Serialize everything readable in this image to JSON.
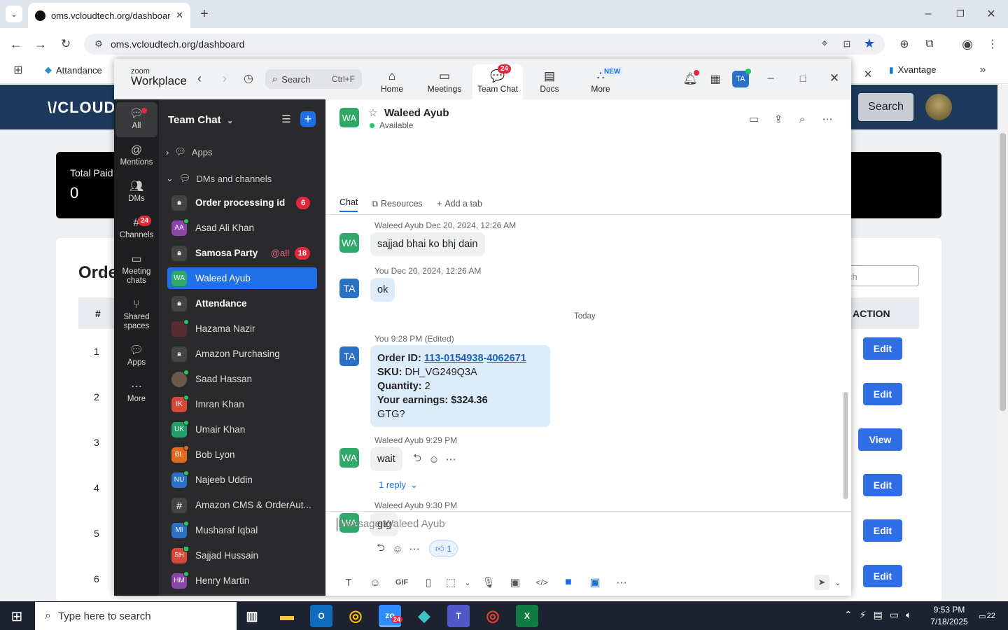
{
  "browser": {
    "tab_title": "oms.vcloudtech.org/dashboard",
    "url": "oms.vcloudtech.org/dashboard",
    "bookmarks": [
      "Attandance",
      "Xvantage"
    ]
  },
  "website": {
    "logo_text": "\\/CLOUDC",
    "search_button": "Search",
    "card_label": "Total Paid",
    "card_value": "0",
    "section_title": "Orde",
    "search_placeholder": "ch",
    "col_hash": "#",
    "col_action": "ACTION",
    "rows": [
      {
        "num": "1",
        "action": "Edit"
      },
      {
        "num": "2",
        "action": "Edit"
      },
      {
        "num": "3",
        "action": "View"
      },
      {
        "num": "4",
        "action": "Edit"
      },
      {
        "num": "5",
        "action": "Edit"
      },
      {
        "num": "6",
        "action": "Edit"
      }
    ]
  },
  "zoom": {
    "brand_small": "zoom",
    "brand": "Workplace",
    "search_label": "Search",
    "search_shortcut": "Ctrl+F",
    "nav": [
      {
        "label": "Home",
        "icon": "home-icon"
      },
      {
        "label": "Meetings",
        "icon": "video-icon"
      },
      {
        "label": "Team Chat",
        "icon": "chat-icon",
        "badge": "24"
      },
      {
        "label": "Docs",
        "icon": "doc-icon"
      },
      {
        "label": "More",
        "icon": "more-icon",
        "badge": "NEW"
      }
    ],
    "profile_initials": "TA",
    "rail": [
      {
        "label": "All"
      },
      {
        "label": "Mentions"
      },
      {
        "label": "DMs"
      },
      {
        "label": "Channels",
        "badge": "24"
      },
      {
        "label": "Meeting chats"
      },
      {
        "label": "Shared spaces"
      },
      {
        "label": "Apps"
      },
      {
        "label": "More"
      }
    ],
    "sidebar": {
      "title": "Team Chat",
      "apps_label": "Apps",
      "dms_label": "DMs and channels",
      "items": [
        {
          "name": "Order processing id",
          "badge": "6"
        },
        {
          "name": "Asad Ali Khan",
          "initials": "AA"
        },
        {
          "name": "Samosa Party",
          "mention": "@all",
          "badge": "18"
        },
        {
          "name": "Waleed Ayub",
          "initials": "WA"
        },
        {
          "name": "Attendance"
        },
        {
          "name": "Hazama Nazir"
        },
        {
          "name": "Amazon Purchasing"
        },
        {
          "name": "Saad Hassan"
        },
        {
          "name": "Imran Khan",
          "initials": "IK"
        },
        {
          "name": "Umair Khan",
          "initials": "UK"
        },
        {
          "name": "Bob Lyon",
          "initials": "BL"
        },
        {
          "name": "Najeeb Uddin",
          "initials": "NU"
        },
        {
          "name": "Amazon CMS & OrderAut...",
          "initials": "#"
        },
        {
          "name": "Musharaf Iqbal",
          "initials": "MI"
        },
        {
          "name": "Sajjad Hussain",
          "initials": "SH"
        },
        {
          "name": "Henry Martin",
          "initials": "HM"
        }
      ]
    },
    "chat": {
      "contact": "Waleed Ayub",
      "contact_initials": "WA",
      "status": "Available",
      "tabs": [
        "Chat",
        "Resources",
        "Add a tab"
      ],
      "messages": [
        {
          "meta": "Waleed Ayub  Dec 20, 2024, 12:26 AM",
          "text": "sajjad bhai ko bhj dain"
        },
        {
          "meta": "You  Dec 20, 2024, 12:26 AM",
          "text": "ok"
        },
        {
          "divider": "Today"
        },
        {
          "meta": "You  9:28 PM (Edited)"
        },
        {
          "meta": "Waleed Ayub  9:29 PM",
          "text": "wait",
          "reply": "1 reply"
        },
        {
          "meta": "Waleed Ayub  9:30 PM",
          "text": "gtg",
          "reaction": "1"
        }
      ],
      "order": {
        "id_label": "Order ID:",
        "id_part1": "113-0154938",
        "id_sep": "-",
        "id_part2": "4062671",
        "sku_label": "SKU:",
        "sku": "DH_VG249Q3A",
        "qty_label": "Quantity:",
        "qty": "2",
        "earnings": "Your earnings: $324.36",
        "tail": "GTG?"
      },
      "composer_placeholder": "Message Waleed Ayub"
    }
  },
  "taskbar": {
    "search_placeholder": "Type here to search",
    "time": "9:53 PM",
    "date": "7/18/2025",
    "notif_count": "22",
    "zoom_badge": "24"
  },
  "colors": {
    "accent": "#1e6fe8",
    "site_header": "#1d3a5c",
    "edit_button": "#2f6ee6",
    "badge_red": "#e5273e"
  }
}
